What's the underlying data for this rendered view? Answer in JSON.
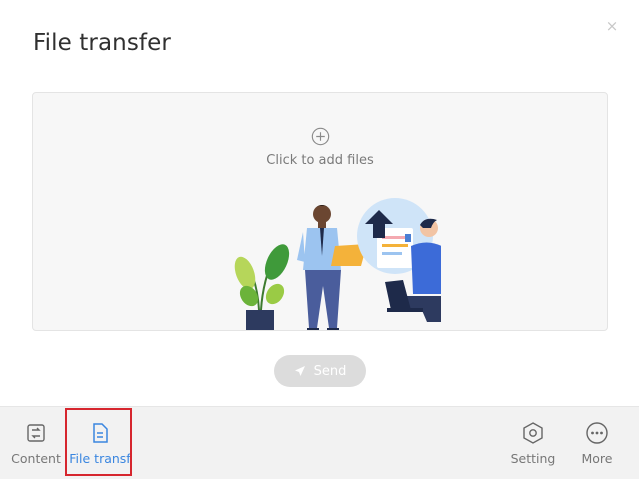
{
  "dialog": {
    "title": "File transfer",
    "close_label": "×"
  },
  "dropzone": {
    "label": "Click to add files"
  },
  "send_button": {
    "label": "Send"
  },
  "bottom_nav": {
    "items": [
      {
        "label": "Content",
        "icon": "content-transfer-icon",
        "active": false
      },
      {
        "label": "File transf",
        "icon": "file-icon",
        "active": true
      },
      {
        "label": "Setting",
        "icon": "hexagon-settings-icon",
        "active": false
      },
      {
        "label": "More",
        "icon": "more-dots-icon",
        "active": false
      }
    ]
  },
  "colors": {
    "accent": "#3a86e0",
    "highlight": "#d6262e",
    "send_disabled": "#dcdcdc"
  }
}
